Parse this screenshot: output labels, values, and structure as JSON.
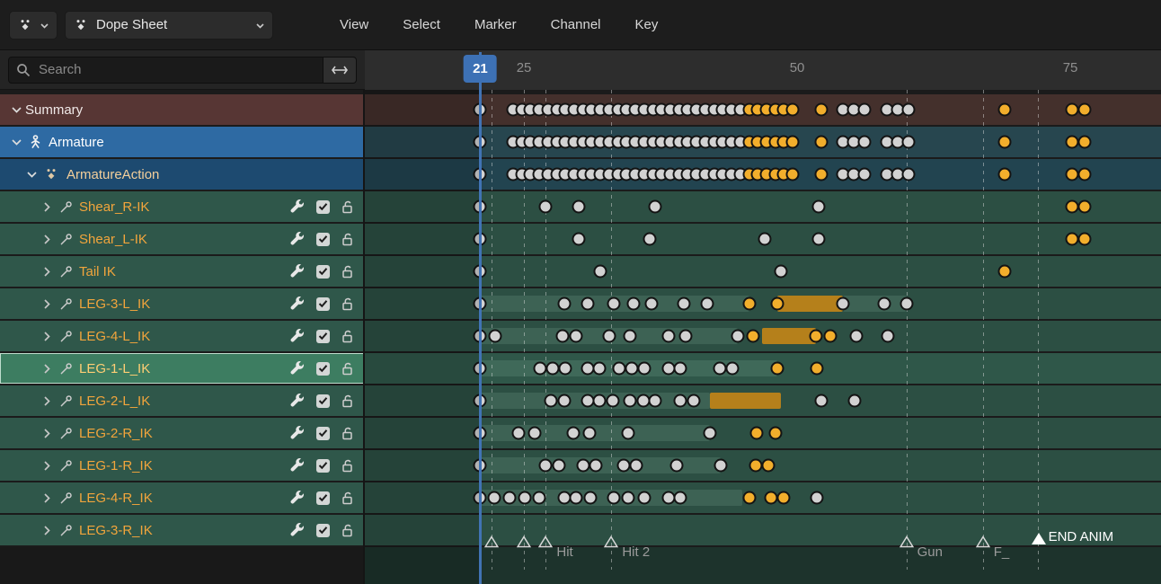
{
  "header": {
    "mode": "Dope Sheet",
    "menus": [
      "View",
      "Select",
      "Marker",
      "Channel",
      "Key"
    ]
  },
  "search": {
    "placeholder": "Search"
  },
  "ruler": {
    "current_frame": 21,
    "ticks": [
      25,
      50,
      75
    ]
  },
  "colors": {
    "playhead": "#3d71b5",
    "keyframe_unselected": "#d2d2d2",
    "keyframe_selected": "#f2ae2c",
    "selected_hold_bar": "#b5801b",
    "bone_channel_text": "#f2a53c"
  },
  "shared_dots": {
    "dense": [
      [
        21,
        0
      ],
      [
        24,
        0
      ],
      [
        24.8,
        0
      ],
      [
        25.6,
        0
      ],
      [
        26.4,
        0
      ],
      [
        27.2,
        0
      ],
      [
        28,
        0
      ],
      [
        28.8,
        0
      ],
      [
        29.6,
        0
      ],
      [
        30.4,
        0
      ],
      [
        31.2,
        0
      ],
      [
        32,
        0
      ],
      [
        32.8,
        0
      ],
      [
        33.6,
        0
      ],
      [
        34.4,
        0
      ],
      [
        35.2,
        0
      ],
      [
        36,
        0
      ],
      [
        36.8,
        0
      ],
      [
        37.6,
        0
      ],
      [
        38.4,
        0
      ],
      [
        39.2,
        0
      ],
      [
        40,
        0
      ],
      [
        40.8,
        0
      ],
      [
        41.6,
        0
      ],
      [
        42.4,
        0
      ],
      [
        43.2,
        0
      ],
      [
        44,
        0
      ],
      [
        44.8,
        0
      ],
      [
        45.6,
        1
      ],
      [
        46.4,
        1
      ],
      [
        47.2,
        1
      ],
      [
        48,
        1
      ],
      [
        48.8,
        1
      ],
      [
        49.6,
        1
      ],
      [
        52.2,
        1
      ],
      [
        54.2,
        0
      ],
      [
        55.2,
        0
      ],
      [
        56.2,
        0
      ],
      [
        58.2,
        0
      ],
      [
        59.2,
        0
      ],
      [
        60.2,
        0
      ],
      [
        69,
        1
      ],
      [
        75.2,
        1
      ],
      [
        76.3,
        1
      ]
    ]
  },
  "channels": [
    {
      "label": "Summary",
      "kind": "summary",
      "indent": 0,
      "expanded": true,
      "dots_ref": "dense",
      "bars": []
    },
    {
      "label": "Armature",
      "kind": "object",
      "indent": 0,
      "expanded": true,
      "dots_ref": "dense",
      "bars": []
    },
    {
      "label": "ArmatureAction",
      "kind": "action",
      "indent": 1,
      "expanded": true,
      "dots_ref": "dense",
      "bars": []
    },
    {
      "label": "Shear_R-IK",
      "kind": "bone",
      "indent": 2,
      "expanded": false,
      "toggles": {
        "wrench": true,
        "enabled": true,
        "locked": false
      },
      "dots": [
        [
          21,
          0
        ],
        [
          27,
          0
        ],
        [
          30,
          0
        ],
        [
          37,
          0
        ],
        [
          52,
          0
        ],
        [
          75.2,
          1
        ],
        [
          76.3,
          1
        ]
      ],
      "bars": []
    },
    {
      "label": "Shear_L-IK",
      "kind": "bone",
      "indent": 2,
      "expanded": false,
      "toggles": {
        "wrench": true,
        "enabled": true,
        "locked": false
      },
      "dots": [
        [
          21,
          0
        ],
        [
          30,
          0
        ],
        [
          36.5,
          0
        ],
        [
          47,
          0
        ],
        [
          52,
          0
        ],
        [
          75.2,
          1
        ],
        [
          76.3,
          1
        ]
      ],
      "bars": []
    },
    {
      "label": "Tail IK",
      "kind": "bone",
      "indent": 2,
      "expanded": false,
      "toggles": {
        "wrench": true,
        "enabled": true,
        "locked": false
      },
      "dots": [
        [
          21,
          0
        ],
        [
          32,
          0
        ],
        [
          48.5,
          0
        ],
        [
          69,
          1
        ]
      ],
      "bars": []
    },
    {
      "label": "LEG-3-L_IK",
      "kind": "bone",
      "indent": 2,
      "expanded": false,
      "toggles": {
        "wrench": true,
        "enabled": true,
        "locked": false
      },
      "dots": [
        [
          21,
          0
        ],
        [
          28.7,
          0
        ],
        [
          30.8,
          0
        ],
        [
          33.2,
          0
        ],
        [
          35,
          0
        ],
        [
          36.7,
          0
        ],
        [
          39.6,
          0
        ],
        [
          41.8,
          0
        ],
        [
          45.6,
          1
        ],
        [
          48.2,
          1
        ],
        [
          54.2,
          0
        ],
        [
          58,
          0
        ],
        [
          60,
          0
        ]
      ],
      "bars": [
        [
          21,
          45.6,
          "hold"
        ],
        [
          48.2,
          54.2,
          "sel"
        ],
        [
          54.2,
          60,
          "hold"
        ]
      ]
    },
    {
      "label": "LEG-4-L_IK",
      "kind": "bone",
      "indent": 2,
      "expanded": false,
      "toggles": {
        "wrench": true,
        "enabled": true,
        "locked": false
      },
      "dots": [
        [
          21,
          0
        ],
        [
          22.4,
          0
        ],
        [
          28.5,
          0
        ],
        [
          29.8,
          0
        ],
        [
          32.8,
          0
        ],
        [
          34.7,
          0
        ],
        [
          38.2,
          0
        ],
        [
          39.8,
          0
        ],
        [
          44.6,
          0
        ],
        [
          46,
          1
        ],
        [
          51.7,
          1
        ],
        [
          53,
          1
        ],
        [
          55.4,
          0
        ],
        [
          58.3,
          0
        ]
      ],
      "bars": [
        [
          21,
          44.6,
          "hold"
        ],
        [
          46.8,
          51.7,
          "sel"
        ]
      ]
    },
    {
      "label": "LEG-1-L_IK",
      "kind": "bone",
      "indent": 2,
      "expanded": false,
      "selected": true,
      "toggles": {
        "wrench": true,
        "enabled": true,
        "locked": false
      },
      "dots": [
        [
          21,
          0
        ],
        [
          26.5,
          0
        ],
        [
          27.6,
          0
        ],
        [
          28.8,
          0
        ],
        [
          30.8,
          0
        ],
        [
          31.9,
          0
        ],
        [
          33.7,
          0
        ],
        [
          34.9,
          0
        ],
        [
          36,
          0
        ],
        [
          38.2,
          0
        ],
        [
          39.3,
          0
        ],
        [
          42.9,
          0
        ],
        [
          44.1,
          0
        ],
        [
          48.2,
          1
        ],
        [
          51.8,
          1
        ]
      ],
      "bars": [
        [
          21,
          48.2,
          "hold"
        ]
      ]
    },
    {
      "label": "LEG-2-L_IK",
      "kind": "bone",
      "indent": 2,
      "expanded": false,
      "toggles": {
        "wrench": true,
        "enabled": true,
        "locked": false
      },
      "dots": [
        [
          21,
          0
        ],
        [
          27.5,
          0
        ],
        [
          28.7,
          0
        ],
        [
          30.8,
          0
        ],
        [
          31.9,
          0
        ],
        [
          33.1,
          0
        ],
        [
          34.7,
          0
        ],
        [
          35.9,
          0
        ],
        [
          37,
          0
        ],
        [
          39.3,
          0
        ],
        [
          40.5,
          0
        ],
        [
          52.2,
          0
        ],
        [
          55.3,
          0
        ]
      ],
      "bars": [
        [
          21,
          42,
          "hold"
        ],
        [
          42,
          48.5,
          "sel"
        ]
      ]
    },
    {
      "label": "LEG-2-R_IK",
      "kind": "bone",
      "indent": 2,
      "expanded": false,
      "toggles": {
        "wrench": true,
        "enabled": true,
        "locked": false
      },
      "dots": [
        [
          21,
          0
        ],
        [
          24.5,
          0
        ],
        [
          26,
          0
        ],
        [
          29.5,
          0
        ],
        [
          31,
          0
        ],
        [
          34.5,
          0
        ],
        [
          42,
          0
        ],
        [
          46.3,
          1
        ],
        [
          48,
          1
        ]
      ],
      "bars": [
        [
          21,
          42,
          "hold"
        ]
      ]
    },
    {
      "label": "LEG-1-R_IK",
      "kind": "bone",
      "indent": 2,
      "expanded": false,
      "toggles": {
        "wrench": true,
        "enabled": true,
        "locked": false
      },
      "dots": [
        [
          21,
          0
        ],
        [
          27,
          0
        ],
        [
          28.2,
          0
        ],
        [
          30.4,
          0
        ],
        [
          31.6,
          0
        ],
        [
          34.1,
          0
        ],
        [
          35.3,
          0
        ],
        [
          39,
          0
        ],
        [
          43,
          0
        ],
        [
          46.2,
          1
        ],
        [
          47.4,
          1
        ]
      ],
      "bars": [
        [
          21,
          43,
          "hold"
        ]
      ]
    },
    {
      "label": "LEG-4-R_IK",
      "kind": "bone",
      "indent": 2,
      "expanded": false,
      "toggles": {
        "wrench": true,
        "enabled": true,
        "locked": false
      },
      "dots": [
        [
          21,
          0
        ],
        [
          22.3,
          0
        ],
        [
          23.7,
          0
        ],
        [
          25.1,
          0
        ],
        [
          26.4,
          0
        ],
        [
          28.7,
          0
        ],
        [
          29.8,
          0
        ],
        [
          31.1,
          0
        ],
        [
          33.2,
          0
        ],
        [
          34.5,
          0
        ],
        [
          36,
          0
        ],
        [
          38.2,
          0
        ],
        [
          39.3,
          0
        ],
        [
          45.6,
          1
        ],
        [
          47.6,
          1
        ],
        [
          48.8,
          1
        ],
        [
          51.8,
          0
        ]
      ],
      "bars": [
        [
          21,
          45,
          "hold"
        ]
      ]
    },
    {
      "label": "LEG-3-R_IK",
      "kind": "bone",
      "indent": 2,
      "expanded": false,
      "toggles": {
        "wrench": true,
        "enabled": true,
        "locked": false
      },
      "dots": [],
      "bars": []
    }
  ],
  "markers": [
    {
      "frame": 22,
      "label": ""
    },
    {
      "frame": 25,
      "label": ""
    },
    {
      "frame": 27,
      "label": "Hit"
    },
    {
      "frame": 33,
      "label": "Hit 2"
    },
    {
      "frame": 60,
      "label": "Gun"
    },
    {
      "frame": 67,
      "label": "F_"
    },
    {
      "frame": 72,
      "label": "END ANIM",
      "selected": true
    }
  ]
}
